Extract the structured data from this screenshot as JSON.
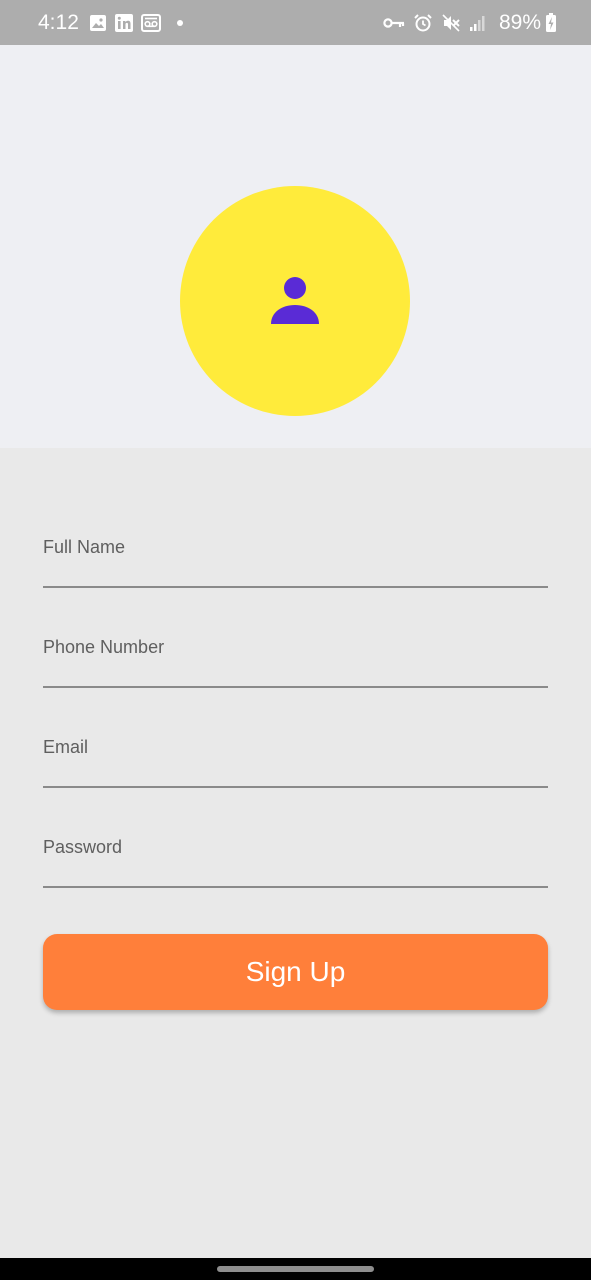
{
  "status_bar": {
    "time": "4:12",
    "left_icons": [
      "gallery-icon",
      "linkedin-icon",
      "voicemail-icon"
    ],
    "right_icons": [
      "key-icon",
      "alarm-icon",
      "mute-icon",
      "signal-icon"
    ],
    "battery": "89%",
    "background": "#adadad"
  },
  "header": {
    "background": "#eeeff3",
    "avatar_color": "#ffeb3b",
    "avatar_icon": "person-icon",
    "avatar_icon_color": "#5a2bd6"
  },
  "form": {
    "fields": [
      {
        "label": "Full Name",
        "value": ""
      },
      {
        "label": "Phone Number",
        "value": ""
      },
      {
        "label": "Email",
        "value": ""
      },
      {
        "label": "Password",
        "value": ""
      }
    ]
  },
  "signup_button": {
    "label": "Sign Up",
    "color": "#ff7f3a"
  }
}
